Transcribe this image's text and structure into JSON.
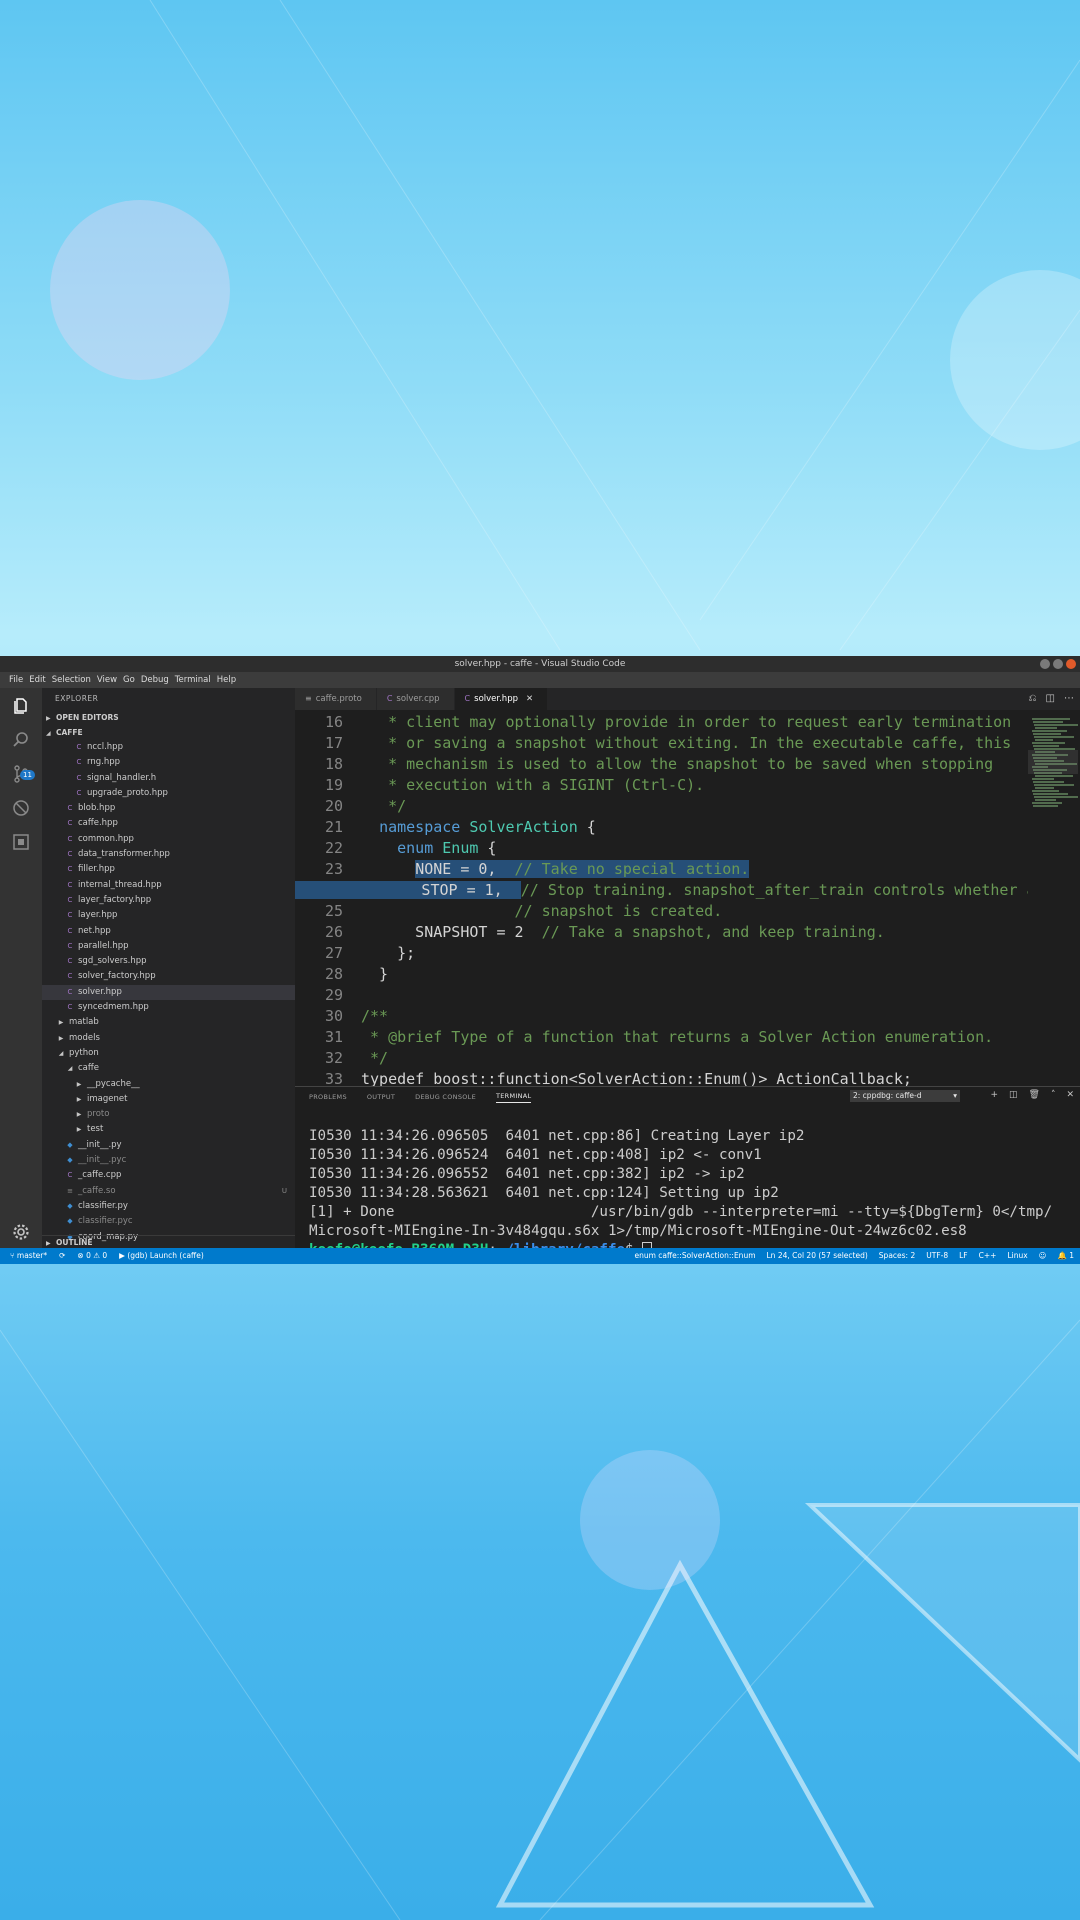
{
  "window": {
    "title": "solver.hpp - caffe - Visual Studio Code"
  },
  "menu": [
    "File",
    "Edit",
    "Selection",
    "View",
    "Go",
    "Debug",
    "Terminal",
    "Help"
  ],
  "activity": {
    "scm_badge": "11"
  },
  "sidebar": {
    "title": "EXPLORER",
    "open_editors": "OPEN EDITORS",
    "root": "CAFFE",
    "items": [
      {
        "label": "nccl.hpp",
        "type": "cpp",
        "indent": 2
      },
      {
        "label": "rng.hpp",
        "type": "cpp",
        "indent": 2
      },
      {
        "label": "signal_handler.h",
        "type": "cpp",
        "indent": 2
      },
      {
        "label": "upgrade_proto.hpp",
        "type": "cpp",
        "indent": 2
      },
      {
        "label": "blob.hpp",
        "type": "cpp",
        "indent": 1
      },
      {
        "label": "caffe.hpp",
        "type": "cpp",
        "indent": 1
      },
      {
        "label": "common.hpp",
        "type": "cpp",
        "indent": 1
      },
      {
        "label": "data_transformer.hpp",
        "type": "cpp",
        "indent": 1
      },
      {
        "label": "filler.hpp",
        "type": "cpp",
        "indent": 1
      },
      {
        "label": "internal_thread.hpp",
        "type": "cpp",
        "indent": 1
      },
      {
        "label": "layer_factory.hpp",
        "type": "cpp",
        "indent": 1
      },
      {
        "label": "layer.hpp",
        "type": "cpp",
        "indent": 1
      },
      {
        "label": "net.hpp",
        "type": "cpp",
        "indent": 1
      },
      {
        "label": "parallel.hpp",
        "type": "cpp",
        "indent": 1
      },
      {
        "label": "sgd_solvers.hpp",
        "type": "cpp",
        "indent": 1
      },
      {
        "label": "solver_factory.hpp",
        "type": "cpp",
        "indent": 1
      },
      {
        "label": "solver.hpp",
        "type": "cpp",
        "indent": 1,
        "selected": true
      },
      {
        "label": "syncedmem.hpp",
        "type": "cpp",
        "indent": 1
      },
      {
        "label": "matlab",
        "type": "folder",
        "indent": 0
      },
      {
        "label": "models",
        "type": "folder",
        "indent": 0
      },
      {
        "label": "python",
        "type": "folder-open",
        "indent": 0
      },
      {
        "label": "caffe",
        "type": "folder-open",
        "indent": 1
      },
      {
        "label": "__pycache__",
        "type": "folder",
        "indent": 2
      },
      {
        "label": "imagenet",
        "type": "folder",
        "indent": 2
      },
      {
        "label": "proto",
        "type": "folder",
        "indent": 2,
        "dim": true
      },
      {
        "label": "test",
        "type": "folder",
        "indent": 2
      },
      {
        "label": "__init__.py",
        "type": "py",
        "indent": 1
      },
      {
        "label": "__init__.pyc",
        "type": "pyc",
        "indent": 1,
        "dim": true
      },
      {
        "label": "_caffe.cpp",
        "type": "cpp",
        "indent": 1
      },
      {
        "label": "_caffe.so",
        "type": "so",
        "indent": 1,
        "dim": true,
        "mark": "U"
      },
      {
        "label": "classifier.py",
        "type": "py",
        "indent": 1
      },
      {
        "label": "classifier.pyc",
        "type": "pyc",
        "indent": 1,
        "dim": true
      },
      {
        "label": "coord_map.py",
        "type": "py",
        "indent": 1
      }
    ],
    "outline": "OUTLINE"
  },
  "tabs": [
    {
      "label": "caffe.proto",
      "icon": "≡",
      "active": false
    },
    {
      "label": "solver.cpp",
      "icon": "C",
      "active": false
    },
    {
      "label": "solver.hpp",
      "icon": "C",
      "active": true
    }
  ],
  "code": {
    "current_line": 24,
    "lines": [
      {
        "n": "16",
        "segs": [
          {
            "t": "   * client may optionally provide in order to request early termination",
            "c": "com"
          }
        ]
      },
      {
        "n": "17",
        "segs": [
          {
            "t": "   * or saving a snapshot without exiting. In the executable caffe, this",
            "c": "com"
          }
        ]
      },
      {
        "n": "18",
        "segs": [
          {
            "t": "   * mechanism is used to allow the snapshot to be saved when stopping",
            "c": "com"
          }
        ]
      },
      {
        "n": "19",
        "segs": [
          {
            "t": "   * execution with a SIGINT (Ctrl-C).",
            "c": "com"
          }
        ]
      },
      {
        "n": "20",
        "segs": [
          {
            "t": "   */",
            "c": "com"
          }
        ]
      },
      {
        "n": "21",
        "segs": [
          {
            "t": "  ",
            "c": "plain"
          },
          {
            "t": "namespace",
            "c": "kw"
          },
          {
            "t": " ",
            "c": "plain"
          },
          {
            "t": "SolverAction",
            "c": "type"
          },
          {
            "t": " {",
            "c": "plain"
          }
        ]
      },
      {
        "n": "22",
        "segs": [
          {
            "t": "    ",
            "c": "plain"
          },
          {
            "t": "enum",
            "c": "kw"
          },
          {
            "t": " ",
            "c": "plain"
          },
          {
            "t": "Enum",
            "c": "type"
          },
          {
            "t": " {",
            "c": "plain"
          }
        ]
      },
      {
        "n": "23",
        "segs": [
          {
            "t": "      ",
            "c": "plain"
          },
          {
            "t": "NONE = 0,  ",
            "c": "plain",
            "sel": true
          },
          {
            "t": "// Take no special action.",
            "c": "com",
            "sel": true
          }
        ]
      },
      {
        "n": "24",
        "segs": [
          {
            "t": "      STOP = 1,  ",
            "c": "plain",
            "sel": true,
            "selpre": true
          },
          {
            "t": "// Stop training. snapshot_after_train controls whether a",
            "c": "com"
          }
        ]
      },
      {
        "n": "25",
        "segs": [
          {
            "t": "                 // snapshot is created.",
            "c": "com"
          }
        ]
      },
      {
        "n": "26",
        "segs": [
          {
            "t": "      SNAPSHOT = 2  ",
            "c": "plain"
          },
          {
            "t": "// Take a snapshot, and keep training.",
            "c": "com"
          }
        ]
      },
      {
        "n": "27",
        "segs": [
          {
            "t": "    };",
            "c": "plain"
          }
        ]
      },
      {
        "n": "28",
        "segs": [
          {
            "t": "  }",
            "c": "plain"
          }
        ]
      },
      {
        "n": "29",
        "segs": []
      },
      {
        "n": "30",
        "segs": [
          {
            "t": "/**",
            "c": "com"
          }
        ]
      },
      {
        "n": "31",
        "segs": [
          {
            "t": " * @brief Type of a function that returns a Solver Action enumeration.",
            "c": "com"
          }
        ]
      },
      {
        "n": "32",
        "segs": [
          {
            "t": " */",
            "c": "com"
          }
        ]
      },
      {
        "n": "33",
        "segs": [
          {
            "t": "typedef boost::function<SolverAction::Enum()> ActionCallback;",
            "c": "plain"
          }
        ]
      }
    ]
  },
  "panel": {
    "tabs": [
      "PROBLEMS",
      "OUTPUT",
      "DEBUG CONSOLE",
      "TERMINAL"
    ],
    "active_tab": "TERMINAL",
    "terminal_select": "2: cppdbg: caffe-d",
    "terminal_lines": [
      "I0530 11:34:26.096505  6401 net.cpp:86] Creating Layer ip2",
      "I0530 11:34:26.096524  6401 net.cpp:408] ip2 <- conv1",
      "I0530 11:34:26.096552  6401 net.cpp:382] ip2 -> ip2",
      "I0530 11:34:28.563621  6401 net.cpp:124] Setting up ip2",
      "[1] + Done                       /usr/bin/gdb --interpreter=mi --tty=${DbgTerm} 0</tmp/",
      "Microsoft-MIEngine-In-3v484gqu.s6x 1>/tmp/Microsoft-MIEngine-Out-24wz6c02.es8"
    ],
    "prompt_user": "keefe@keefe-B360M-D3H",
    "prompt_path": "~/library/caffe",
    "prompt_symbol": "$ "
  },
  "status": {
    "branch": "master*",
    "errors": "0",
    "warnings": "0",
    "launch": "(gdb) Launch (caffe)",
    "symbol": "enum caffe::SolverAction::Enum",
    "position": "Ln 24, Col 20 (57 selected)",
    "spaces": "Spaces: 2",
    "encoding": "UTF-8",
    "eol": "LF",
    "language": "C++",
    "os": "Linux",
    "notifications": "1"
  },
  "colors": {
    "statusbar": "#007acc",
    "accent": "#1f78c8"
  }
}
